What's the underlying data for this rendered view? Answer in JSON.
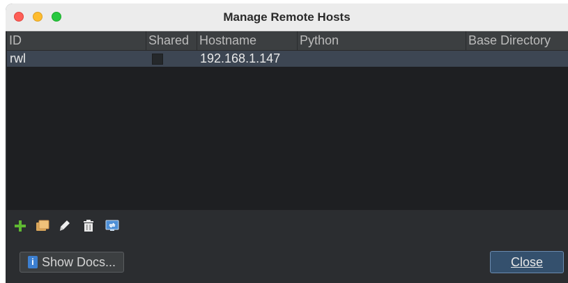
{
  "window": {
    "title": "Manage Remote Hosts"
  },
  "table": {
    "columns": [
      "ID",
      "Shared",
      "Hostname",
      "Python",
      "Base Directory"
    ],
    "rows": [
      {
        "id": "rwl",
        "shared": false,
        "hostname": "192.168.1.147",
        "python": "",
        "base_directory": ""
      }
    ]
  },
  "toolbar": {
    "icons": [
      "add-host-icon",
      "copy-host-icon",
      "edit-host-icon",
      "delete-host-icon",
      "remote-desktop-icon"
    ]
  },
  "buttons": {
    "show_docs_label": "Show Docs...",
    "close_label": "Close"
  },
  "colors": {
    "accent": "#34506d",
    "selection_row": "#3d4653",
    "add_green": "#5fb832"
  }
}
